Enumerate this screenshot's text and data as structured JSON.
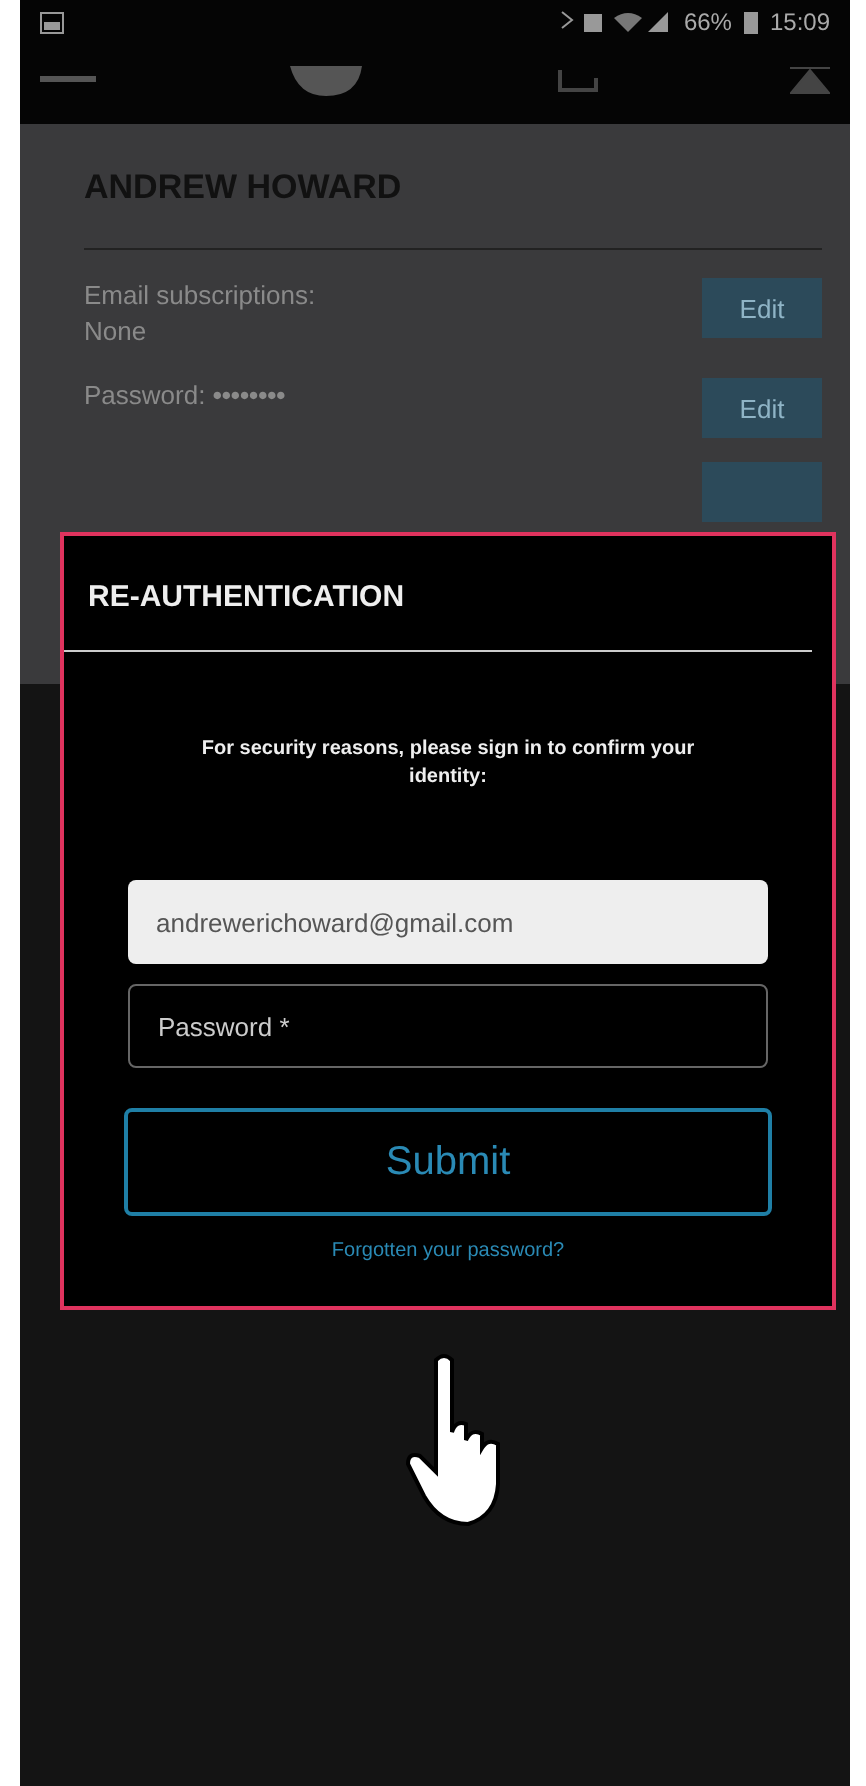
{
  "status_bar": {
    "battery": "66%",
    "time": "15:09"
  },
  "profile": {
    "name": "ANDREW HOWARD",
    "rows": [
      {
        "label": "Email subscriptions:",
        "value": "None",
        "button": "Edit"
      },
      {
        "label": "Password:",
        "value": "••••••••",
        "button": "Edit"
      }
    ]
  },
  "dialog": {
    "title": "RE-AUTHENTICATION",
    "message": "For security reasons, please sign in to confirm your identity:",
    "email": {
      "value": "andrewerichoward@gmail.com"
    },
    "password": {
      "placeholder": "Password *"
    },
    "submit": "Submit",
    "forgot_link": "Forgotten your password?"
  }
}
